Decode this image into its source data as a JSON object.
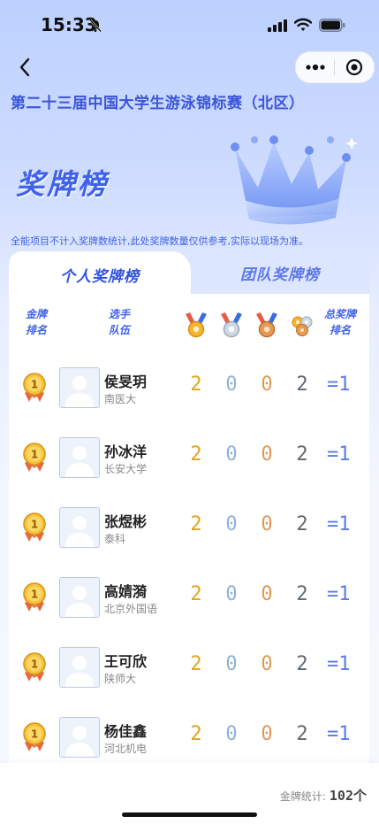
{
  "status_bar": {
    "time": "15:33",
    "icons": [
      "mute-icon",
      "signal-icon",
      "wifi-icon",
      "battery-icon"
    ]
  },
  "nav": {
    "back_icon": "chevron-left-icon",
    "more_icon": "more-dots-icon",
    "close_icon": "target-close-icon"
  },
  "event_title": "第二十三届中国大学生游泳锦标赛（北区）",
  "banner_title": "奖牌榜",
  "notice": "全能项目不计入奖牌数统计,此处奖牌数量仅供参考,实际以现场为准。",
  "tabs": [
    {
      "label": "个人奖牌榜",
      "active": true
    },
    {
      "label": "团队奖牌榜",
      "active": false
    }
  ],
  "headers": {
    "gold_rank": "金牌\n排名",
    "athlete": "选手\n队伍",
    "medal_icons": [
      "gold-medal-icon",
      "silver-medal-icon",
      "bronze-medal-icon",
      "total-medals-icon"
    ],
    "total_rank": "总奖牌\n排名"
  },
  "rows": [
    {
      "name": "侯旻玥",
      "team": "南医大",
      "gold": "2",
      "silver": "0",
      "bronze": "0",
      "total": "2",
      "total_rank": "=1"
    },
    {
      "name": "孙冰洋",
      "team": "长安大学",
      "gold": "2",
      "silver": "0",
      "bronze": "0",
      "total": "2",
      "total_rank": "=1"
    },
    {
      "name": "张煜彬",
      "team": "泰科",
      "gold": "2",
      "silver": "0",
      "bronze": "0",
      "total": "2",
      "total_rank": "=1"
    },
    {
      "name": "高婧漪",
      "team": "北京外国语",
      "gold": "2",
      "silver": "0",
      "bronze": "0",
      "total": "2",
      "total_rank": "=1"
    },
    {
      "name": "王可欣",
      "team": "陕师大",
      "gold": "2",
      "silver": "0",
      "bronze": "0",
      "total": "2",
      "total_rank": "=1"
    },
    {
      "name": "杨佳鑫",
      "team": "河北机电",
      "gold": "2",
      "silver": "0",
      "bronze": "0",
      "total": "2",
      "total_rank": "=1"
    }
  ],
  "gold_rank_icon": "gold-medal-rank-1-icon",
  "gold_rank_number": "1",
  "footer": {
    "gold_stat_label": "金牌统计:",
    "gold_stat_value": "102个"
  },
  "colors": {
    "accent": "#3f62e8",
    "gold": "#e0a422",
    "silver": "#8fb2d6",
    "bronze": "#dc9a58",
    "total": "#606870"
  }
}
